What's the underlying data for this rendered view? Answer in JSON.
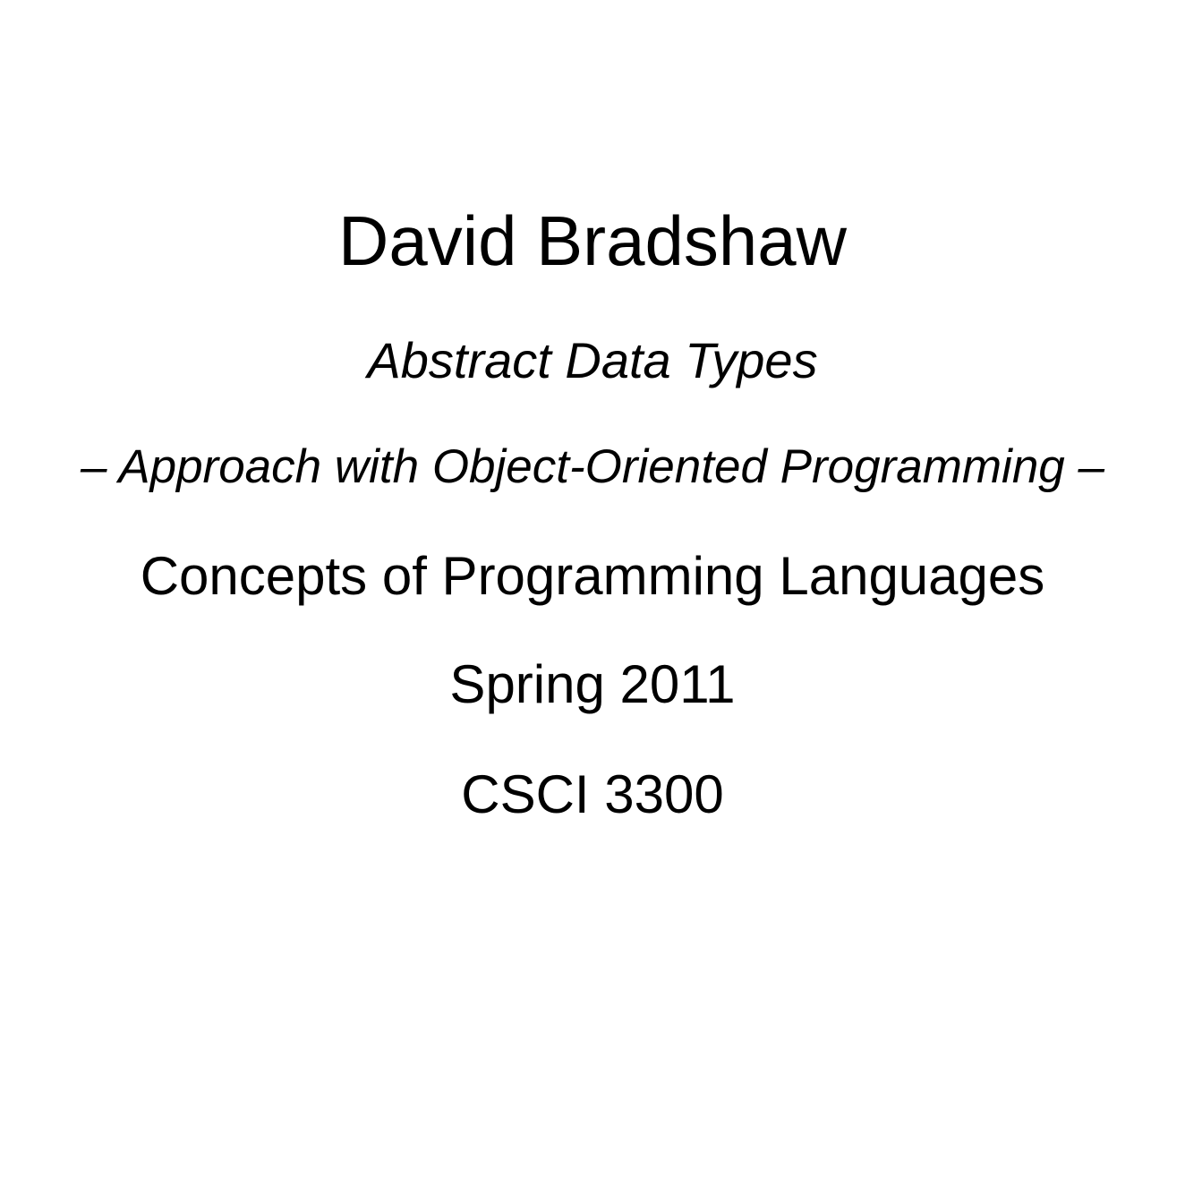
{
  "title_page": {
    "author": "David Bradshaw",
    "topic": "Abstract Data Types",
    "approach": "– Approach with Object-Oriented Programming –",
    "course": "Concepts of Programming Languages",
    "term": "Spring 2011",
    "code": "CSCI 3300"
  },
  "colors": {
    "background": "#ffffff",
    "text": "#000000"
  }
}
